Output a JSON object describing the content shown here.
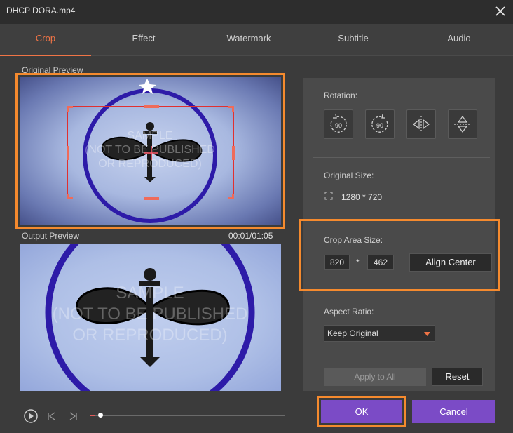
{
  "window": {
    "title": "DHCP DORA.mp4"
  },
  "tabs": [
    {
      "label": "Crop",
      "active": true
    },
    {
      "label": "Effect"
    },
    {
      "label": "Watermark"
    },
    {
      "label": "Subtitle"
    },
    {
      "label": "Audio"
    }
  ],
  "preview": {
    "original_label": "Original Preview",
    "output_label": "Output Preview",
    "timecode": "00:01/01:05",
    "watermark_lines": [
      "SAMPLE",
      "(NOT TO BE PUBLISHED",
      "OR REPRODUCED)"
    ]
  },
  "player": {
    "progress": 0.02
  },
  "rotation": {
    "label": "Rotation:",
    "cw_value": "90",
    "ccw_value": "90"
  },
  "original_size": {
    "label": "Original Size:",
    "value": "1280 * 720"
  },
  "crop_area": {
    "label": "Crop Area Size:",
    "width": "820",
    "separator": "*",
    "height": "462",
    "align_label": "Align Center"
  },
  "aspect_ratio": {
    "label": "Aspect Ratio:",
    "selected": "Keep Original"
  },
  "actions": {
    "apply_all": "Apply to All",
    "reset": "Reset",
    "ok": "OK",
    "cancel": "Cancel"
  },
  "colors": {
    "accent": "#f07446",
    "highlight": "#f58a2e",
    "purple": "#7b4bc6",
    "crop_rect": "#e03030"
  }
}
